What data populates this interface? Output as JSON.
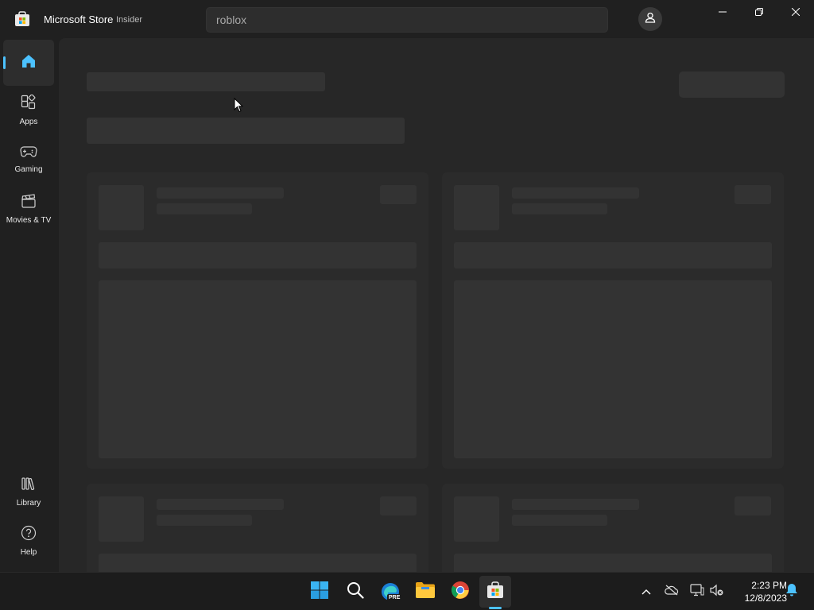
{
  "titlebar": {
    "app_title": "Microsoft Store",
    "badge": "Insider",
    "search_value": "roblox",
    "account_icon": "person-icon",
    "minimize_icon": "minimize-icon",
    "maximize_icon": "restore-icon",
    "close_icon": "close-icon"
  },
  "sidebar": {
    "items": [
      {
        "label": "",
        "icon": "home-icon",
        "active": true
      },
      {
        "label": "Apps",
        "icon": "apps-icon"
      },
      {
        "label": "Gaming",
        "icon": "gamepad-icon"
      },
      {
        "label": "Movies & TV",
        "icon": "clapperboard-icon"
      }
    ],
    "bottom_items": [
      {
        "label": "Library",
        "icon": "library-icon"
      },
      {
        "label": "Help",
        "icon": "help-icon"
      }
    ]
  },
  "content": {
    "state": "loading-skeleton"
  },
  "taskbar": {
    "pinned": [
      "windows-start-icon",
      "search-icon",
      "edge-preview-icon",
      "file-explorer-icon",
      "chrome-icon",
      "microsoft-store-icon"
    ],
    "edge_badge": "PRE",
    "tray": [
      "chevron-up-icon",
      "onedrive-offline-icon",
      "network-icon",
      "volume-muted-icon"
    ],
    "time": "2:23 PM",
    "date": "12/8/2023",
    "notification_icon": "bell-icon"
  },
  "colors": {
    "accent": "#4cc2ff",
    "background": "#202020",
    "content_background": "#272727",
    "skeleton": "#333333"
  }
}
